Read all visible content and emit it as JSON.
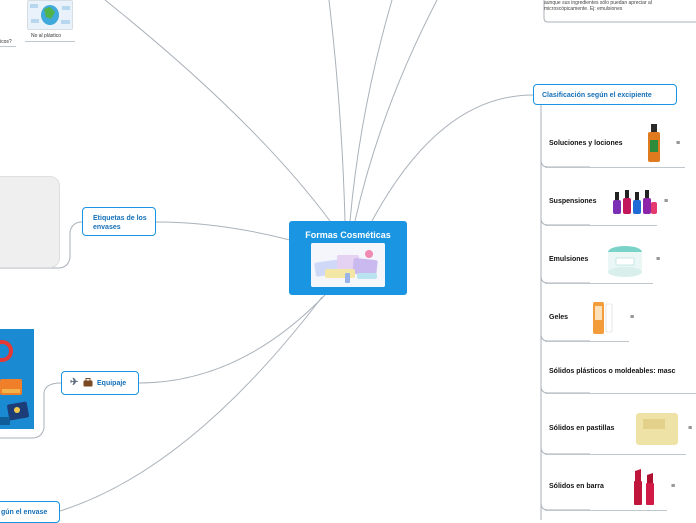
{
  "central": {
    "title": "Formas Cosméticas"
  },
  "clasificacion": {
    "label": "Clasificación según el excipiente",
    "items": [
      {
        "label": "Soluciones y lociones",
        "menu": "≡"
      },
      {
        "label": "Suspensiones",
        "menu": "≡"
      },
      {
        "label": "Emulsiones",
        "menu": "≡"
      },
      {
        "label": "Geles",
        "menu": "≡"
      },
      {
        "label": "Sólidos plásticos o moldeables: masc"
      },
      {
        "label": "Sólidos en pastillas",
        "menu": "≡"
      },
      {
        "label": "Sólidos en barra",
        "menu": "≡"
      }
    ]
  },
  "etiquetas": {
    "label": "Etiquetas de los envases"
  },
  "equipaje": {
    "label": "Equipaje"
  },
  "segun_envase": {
    "label": "gún el envase"
  },
  "no_plastico": {
    "label": "No al plástico"
  },
  "edge_text": {
    "label": "icos?"
  },
  "top_note": {
    "line1": "aunque sus ingredientes sólo puedan apreciar al",
    "line2": "microscópicamente. Ej: emulsiones"
  },
  "colors": {
    "accent": "#1a95e1",
    "topic_text": "#1570b8",
    "connector": "#aab2bb"
  },
  "icons": [
    "airplane-icon",
    "briefcase-icon",
    "menu-icon"
  ]
}
